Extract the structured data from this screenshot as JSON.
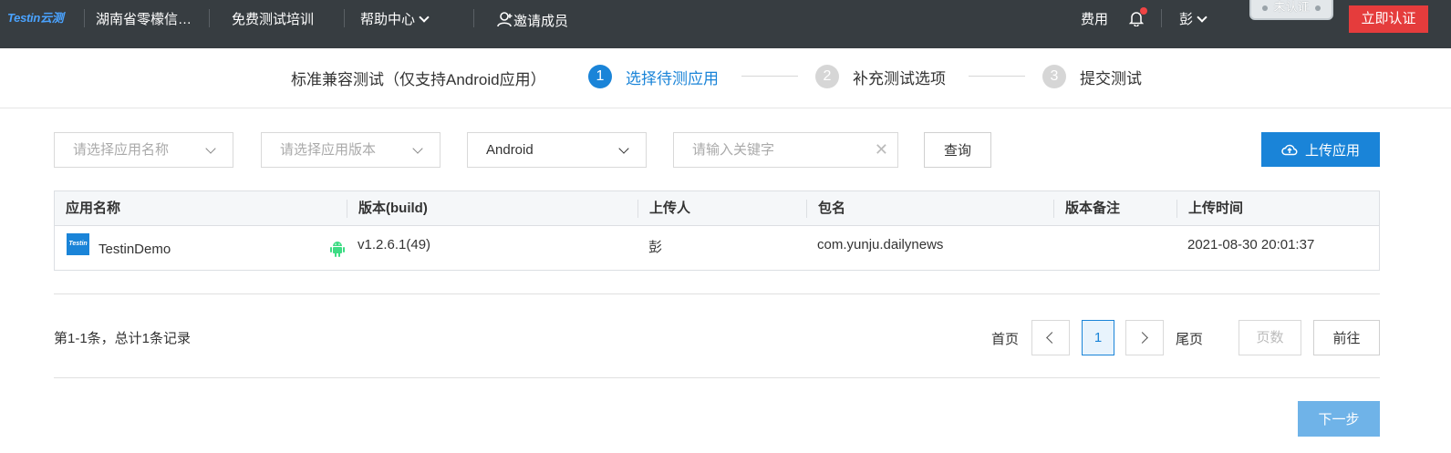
{
  "topbar": {
    "logo": "Testin云测",
    "org": "湖南省零檬信…",
    "training": "免费测试培训",
    "help": "帮助中心",
    "invite": "邀请成员",
    "fees": "费用",
    "user": "彭",
    "unverified": "未认证",
    "verify_now": "立即认证"
  },
  "steps": {
    "title": "标准兼容测试（仅支持Android应用）",
    "items": [
      {
        "num": "1",
        "label": "选择待测应用"
      },
      {
        "num": "2",
        "label": "补充测试选项"
      },
      {
        "num": "3",
        "label": "提交测试"
      }
    ]
  },
  "filters": {
    "app_name_placeholder": "请选择应用名称",
    "app_version_placeholder": "请选择应用版本",
    "platform": "Android",
    "keyword_placeholder": "请输入关键字",
    "query": "查询",
    "upload": "上传应用"
  },
  "table": {
    "headers": [
      "应用名称",
      "版本(build)",
      "上传人",
      "包名",
      "版本备注",
      "上传时间"
    ],
    "rows": [
      {
        "icon_text": "Testin",
        "name": "TestinDemo",
        "version": "v1.2.6.1(49)",
        "uploader": "彭",
        "package": "com.yunju.dailynews",
        "note": "",
        "time": "2021-08-30 20:01:37"
      }
    ]
  },
  "pagination": {
    "total": "第1-1条，总计1条记录",
    "first": "首页",
    "current": "1",
    "last": "尾页",
    "page_placeholder": "页数",
    "goto": "前往"
  },
  "next_step": "下一步",
  "colors": {
    "topbar_bg": "#373d41",
    "accent": "#1a84d8",
    "verify_red": "#e53c3c",
    "android_green": "#3ddc84"
  }
}
